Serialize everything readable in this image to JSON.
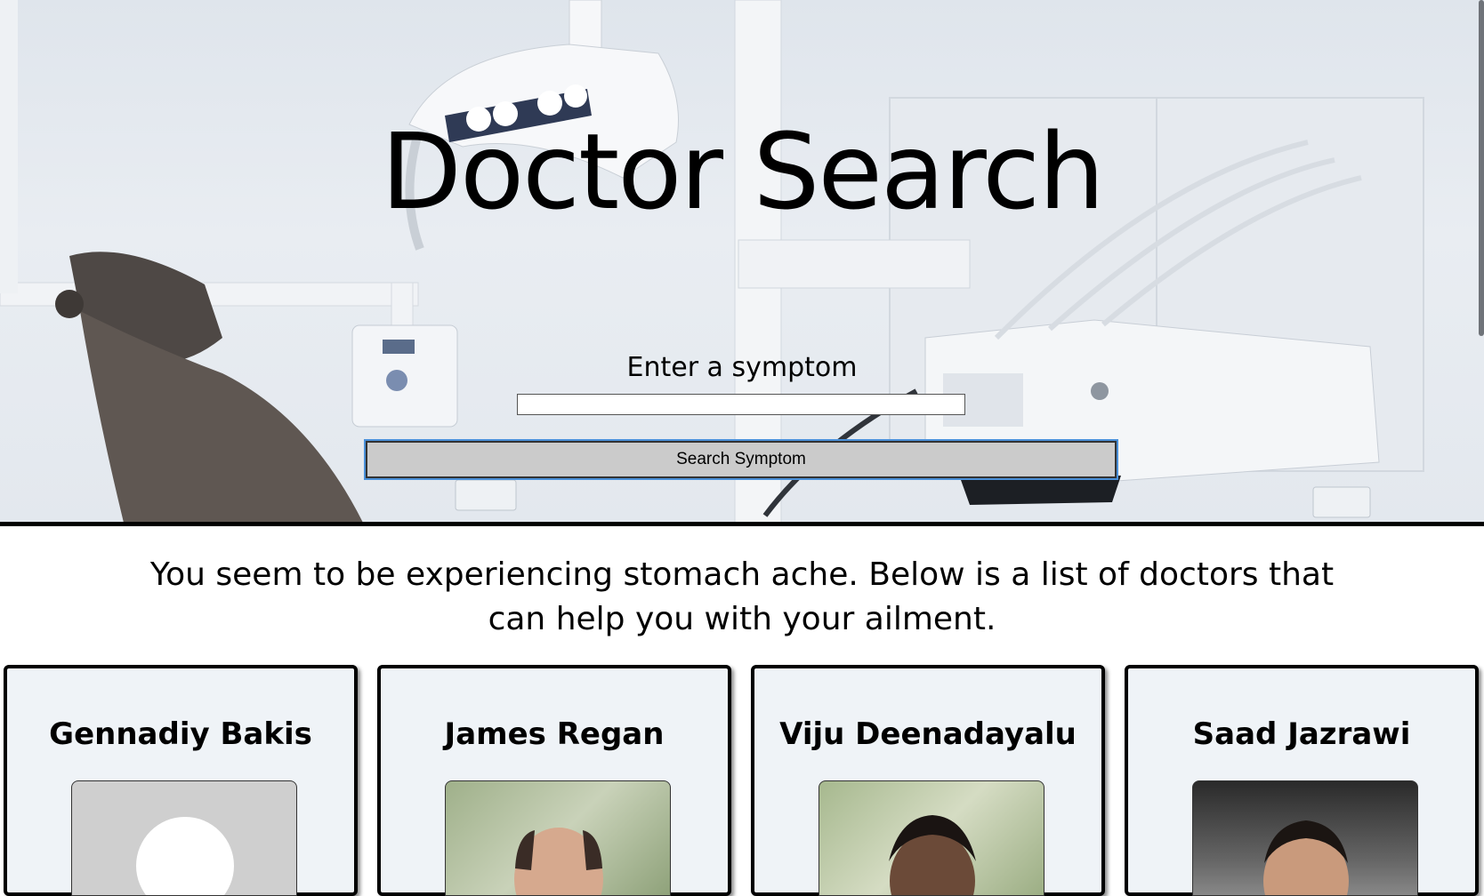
{
  "hero": {
    "title": "Doctor Search",
    "symptom_label": "Enter a symptom",
    "symptom_input": {
      "value": "",
      "placeholder": ""
    },
    "search_button": "Search Symptom"
  },
  "results": {
    "message": "You seem to be experiencing stomach ache. Below is a list of doctors that can help you with your ailment.",
    "doctors": [
      {
        "name": "Gennadiy Bakis",
        "photo": "default-avatar"
      },
      {
        "name": "James Regan",
        "photo": "photo"
      },
      {
        "name": "Viju Deenadayalu",
        "photo": "photo"
      },
      {
        "name": "Saad Jazrawi",
        "photo": "photo"
      }
    ]
  },
  "colors": {
    "accent": "#4a90d9",
    "card_background": "#eff3f7",
    "button_background": "#cbcbcb"
  }
}
